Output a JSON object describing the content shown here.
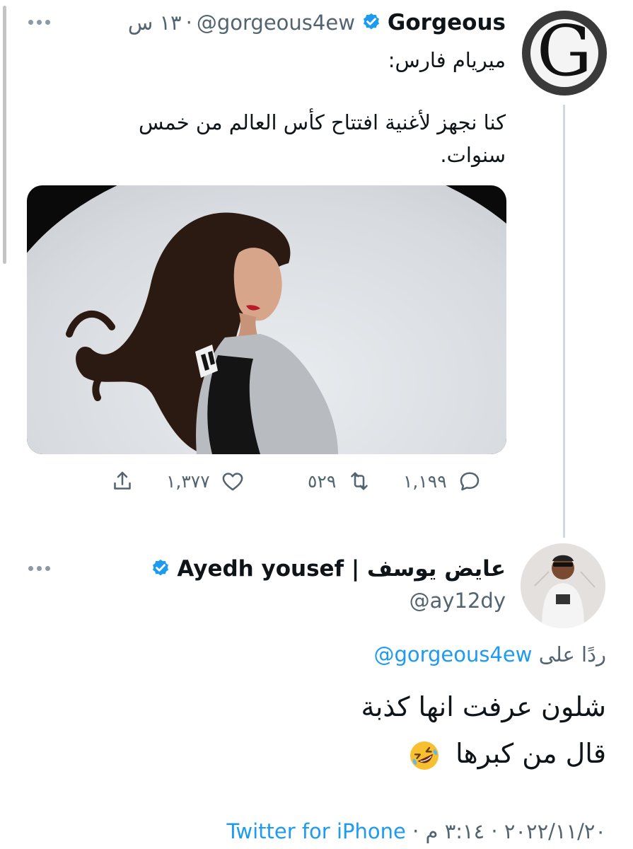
{
  "tweet": {
    "author_name": "Gorgeous",
    "author_handle": "@gorgeous4ew",
    "separator": "·",
    "time_ago": "١٣ س",
    "label": "ميريام فارس:",
    "body": "كنا نجهز لأغنية افتتاح كأس العالم من خمس سنوات.",
    "avatar_letter": "G",
    "stats": {
      "replies": "١,١٩٩",
      "retweets": "٥٢٩",
      "likes": "١,٣٧٧"
    }
  },
  "reply": {
    "author_name": "عايض يوسف | Ayedh yousef",
    "author_handle": "@ay12dy",
    "replying_prefix": "ردًا على",
    "replying_to": "@gorgeous4ew",
    "body_line1": "شلون عرفت انها كذبة",
    "body_line2": "قال من كبرها",
    "emoji": "rolling-on-floor-laughing",
    "date": "٢٠٢٢/١١/٢٠",
    "time": "٣:١٤ م",
    "separator": "·",
    "source": "Twitter for iPhone"
  },
  "colors": {
    "accent": "#1d9bf0",
    "muted": "#536471",
    "text": "#0f1419",
    "thread_line": "#cfd9de"
  }
}
